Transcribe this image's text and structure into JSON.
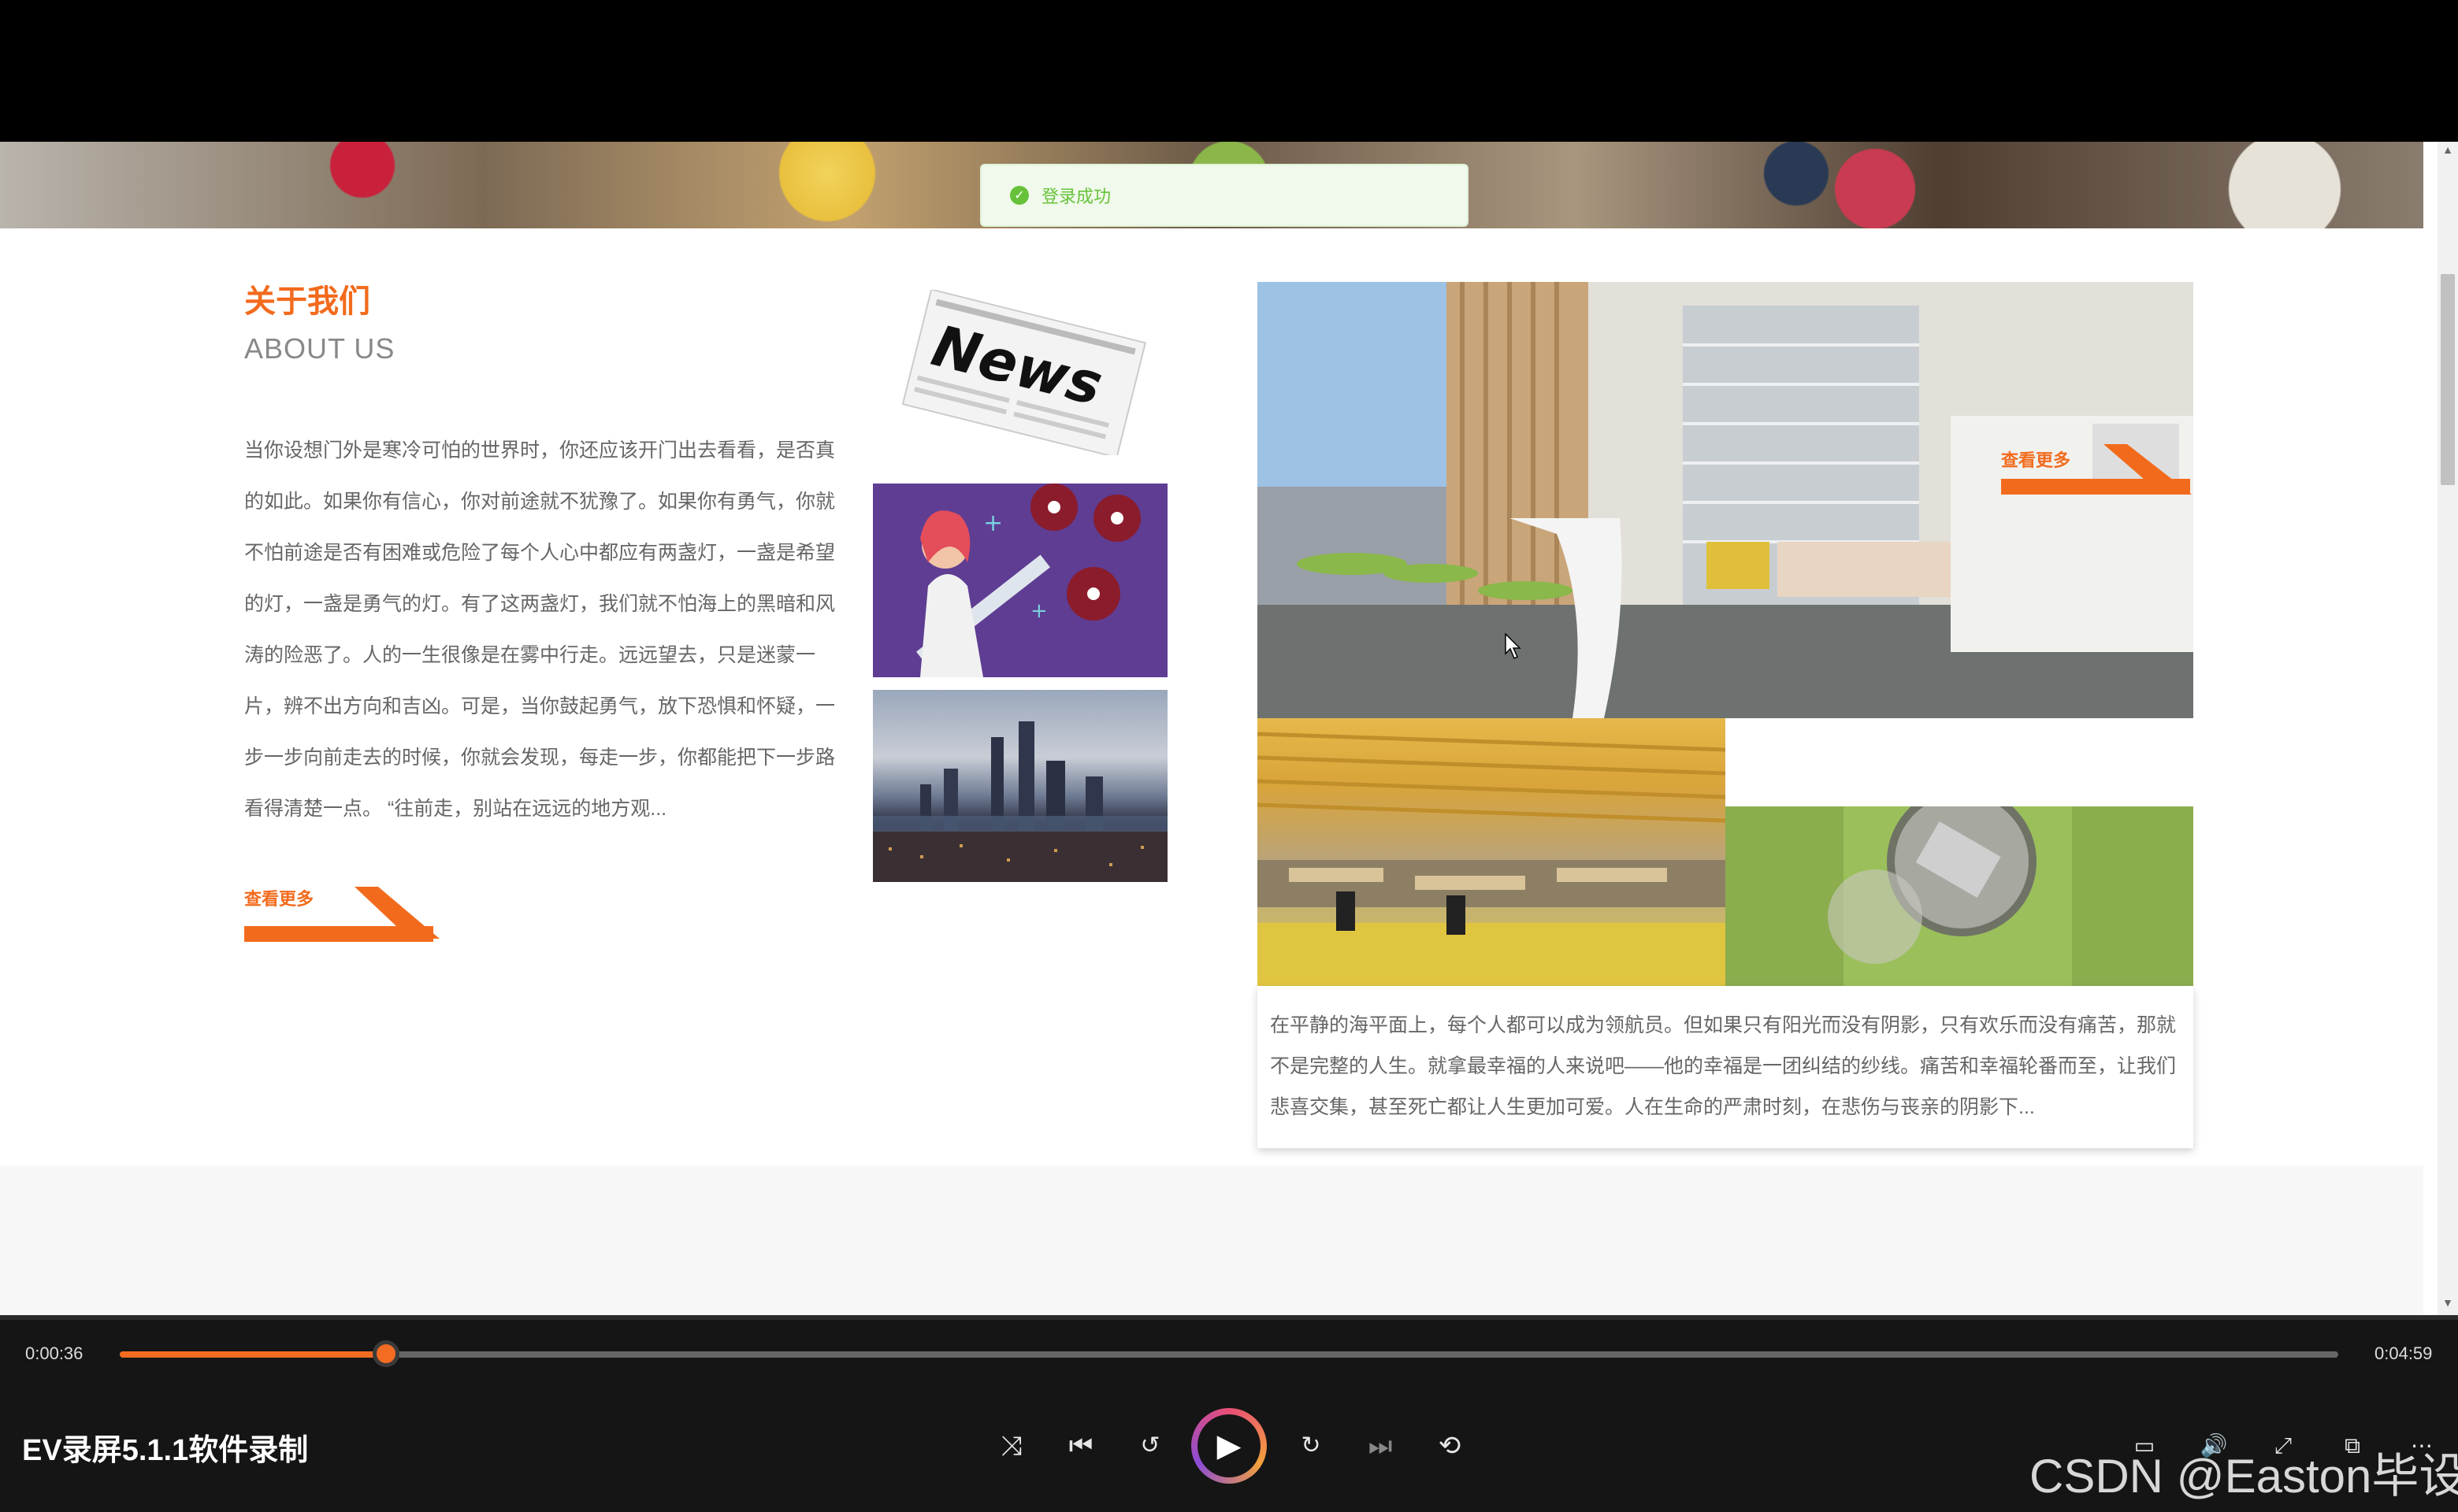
{
  "toast": {
    "message": "登录成功"
  },
  "about": {
    "title": "关于我们",
    "subtitle": "ABOUT US",
    "text": "当你设想门外是寒冷可怕的世界时，你还应该开门出去看看，是否真的如此。如果你有信心，你对前途就不犹豫了。如果你有勇气，你就不怕前途是否有困难或危险了每个人心中都应有两盏灯，一盏是希望的灯，一盏是勇气的灯。有了这两盏灯，我们就不怕海上的黑暗和风涛的险恶了。人的一生很像是在雾中行走。远远望去，只是迷蒙一片，辨不出方向和吉凶。可是，当你鼓起勇气，放下恐惧和怀疑，一步一步向前走去的时候，你就会发现，每走一步，你都能把下一步路看得清楚一点。 “往前走，别站在远远的地方观...",
    "more_label": "查看更多"
  },
  "images": {
    "news_text": "News"
  },
  "card": {
    "text": "在平静的海平面上，每个人都可以成为领航员。但如果只有阳光而没有阴影，只有欢乐而没有痛苦，那就不是完整的人生。就拿最幸福的人来说吧——他的幸福是一团纠结的纱线。痛苦和幸福轮番而至，让我们悲喜交集，甚至死亡都让人生更加可爱。人在生命的严肃时刻，在悲伤与丧亲的阴影下...",
    "more_label": "查看更多"
  },
  "player": {
    "current_time": "0:00:36",
    "total_time": "0:04:59",
    "progress_fraction": 0.12,
    "title": "EV录屏5.1.1软件录制",
    "accent": "#f36c21",
    "controls": [
      "shuffle-icon",
      "previous-icon",
      "rewind-10-icon",
      "play-icon",
      "forward-30-icon",
      "next-icon",
      "repeat-off-icon"
    ],
    "right_controls": [
      "subtitles-icon",
      "volume-icon",
      "fullscreen-icon",
      "mini-player-icon",
      "more-icon"
    ]
  },
  "watermark": "CSDN @Easton毕设"
}
